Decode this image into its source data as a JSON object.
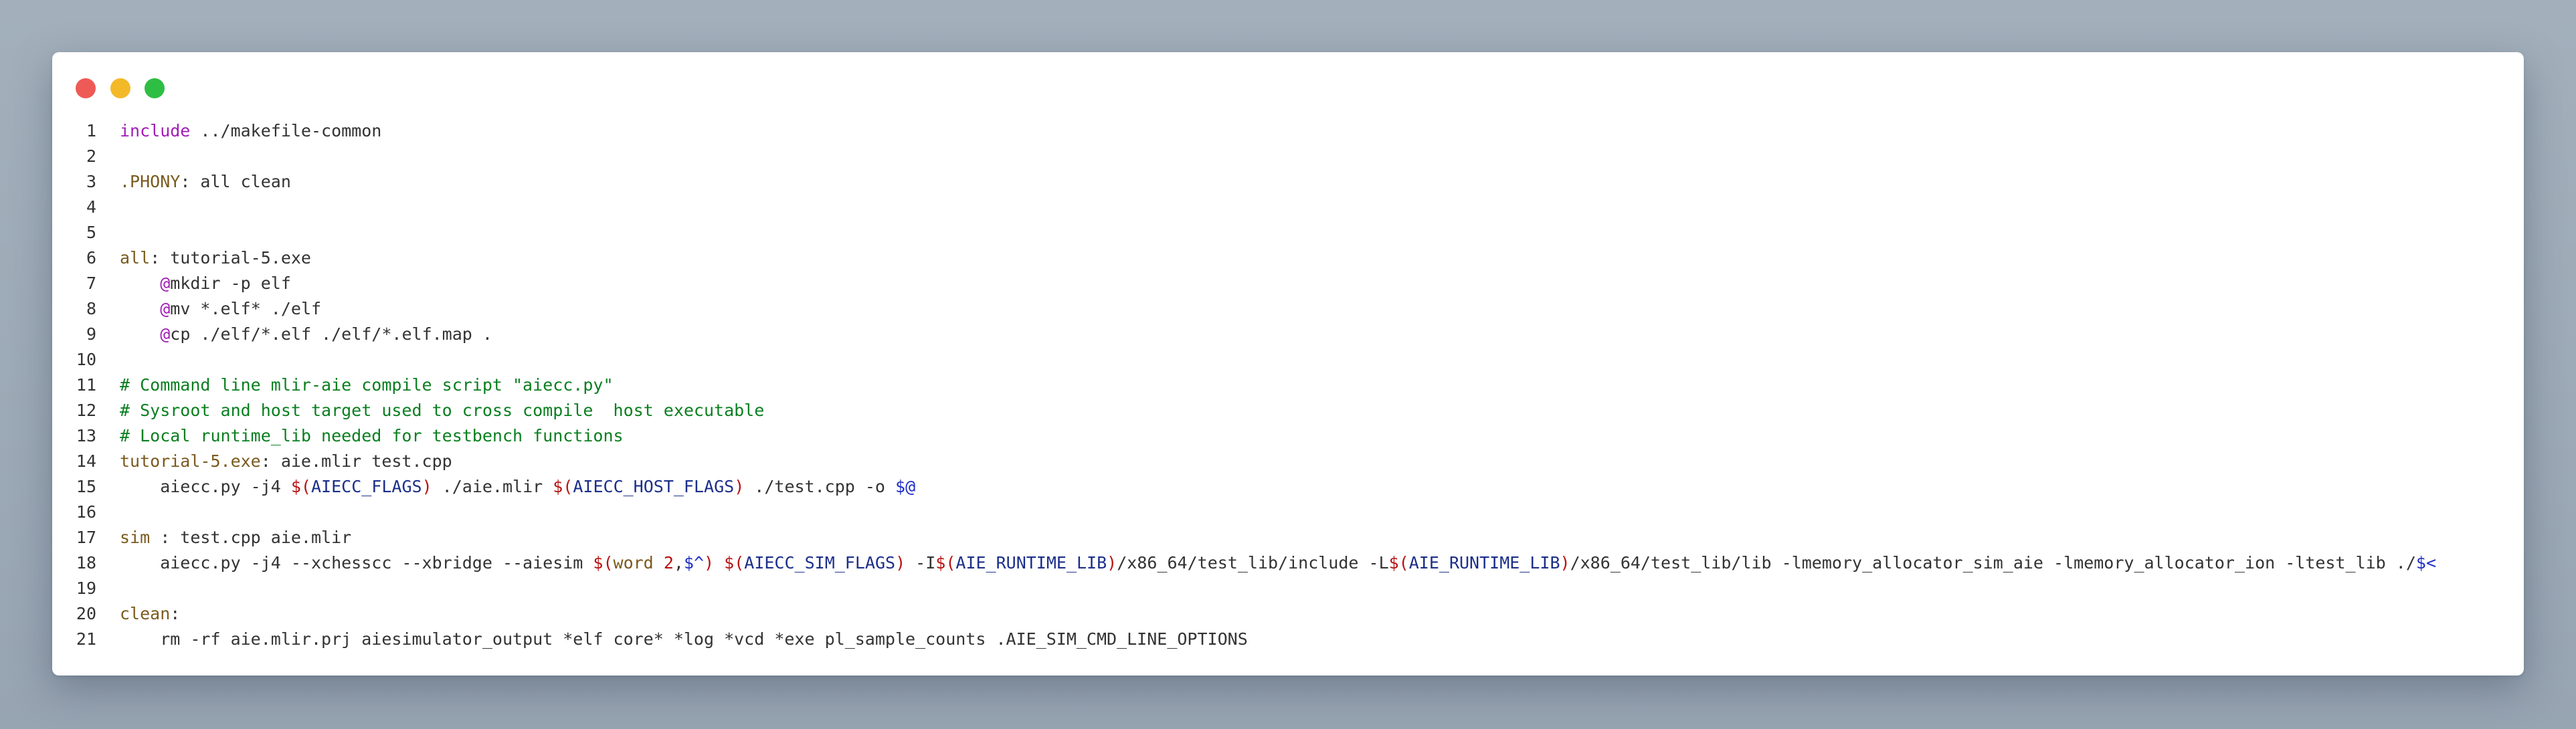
{
  "window": {
    "controls": [
      "close",
      "minimize",
      "maximize"
    ],
    "colors": {
      "close": "#ee5a56",
      "minimize": "#f4b929",
      "maximize": "#2fbe44"
    }
  },
  "code": {
    "language": "makefile",
    "lines": [
      {
        "n": "1",
        "tokens": [
          [
            "kw",
            "include"
          ],
          [
            "p",
            " ../makefile-common"
          ]
        ]
      },
      {
        "n": "2",
        "tokens": []
      },
      {
        "n": "3",
        "tokens": [
          [
            "tg",
            ".PHONY"
          ],
          [
            "p",
            ": all clean"
          ]
        ]
      },
      {
        "n": "4",
        "tokens": []
      },
      {
        "n": "5",
        "tokens": []
      },
      {
        "n": "6",
        "tokens": [
          [
            "tg",
            "all"
          ],
          [
            "p",
            ": tutorial-5.exe"
          ]
        ]
      },
      {
        "n": "7",
        "tokens": [
          [
            "p",
            "    "
          ],
          [
            "at",
            "@"
          ],
          [
            "p",
            "mkdir -p elf"
          ]
        ]
      },
      {
        "n": "8",
        "tokens": [
          [
            "p",
            "    "
          ],
          [
            "at",
            "@"
          ],
          [
            "p",
            "mv *.elf* ./elf"
          ]
        ]
      },
      {
        "n": "9",
        "tokens": [
          [
            "p",
            "    "
          ],
          [
            "at",
            "@"
          ],
          [
            "p",
            "cp ./elf/*.elf ./elf/*.elf.map ."
          ]
        ]
      },
      {
        "n": "10",
        "tokens": []
      },
      {
        "n": "11",
        "tokens": [
          [
            "cm",
            "# Command line mlir-aie compile script \"aiecc.py\""
          ]
        ]
      },
      {
        "n": "12",
        "tokens": [
          [
            "cm",
            "# Sysroot and host target used to cross compile  host executable"
          ]
        ]
      },
      {
        "n": "13",
        "tokens": [
          [
            "cm",
            "# Local runtime_lib needed for testbench functions"
          ]
        ]
      },
      {
        "n": "14",
        "tokens": [
          [
            "tg",
            "tutorial-5.exe"
          ],
          [
            "p",
            ": aie.mlir test.cpp"
          ]
        ]
      },
      {
        "n": "15",
        "tokens": [
          [
            "p",
            "    aiecc.py -j4 "
          ],
          [
            "dl",
            "$("
          ],
          [
            "vr",
            "AIECC_FLAGS"
          ],
          [
            "dl",
            ")"
          ],
          [
            "p",
            " ./aie.mlir "
          ],
          [
            "dl",
            "$("
          ],
          [
            "vr",
            "AIECC_HOST_FLAGS"
          ],
          [
            "dl",
            ")"
          ],
          [
            "p",
            " ./test.cpp -o "
          ],
          [
            "bl",
            "$@"
          ]
        ]
      },
      {
        "n": "16",
        "tokens": []
      },
      {
        "n": "17",
        "tokens": [
          [
            "tg",
            "sim"
          ],
          [
            "p",
            " : test.cpp aie.mlir"
          ]
        ]
      },
      {
        "n": "18",
        "tokens": [
          [
            "p",
            "    aiecc.py -j4 --xchesscc --xbridge --aiesim "
          ],
          [
            "dl",
            "$("
          ],
          [
            "fn",
            "word"
          ],
          [
            "p",
            " "
          ],
          [
            "nm",
            "2"
          ],
          [
            "p",
            ","
          ],
          [
            "bl",
            "$^"
          ],
          [
            "dl",
            ")"
          ],
          [
            "p",
            " "
          ],
          [
            "dl",
            "$("
          ],
          [
            "vr",
            "AIECC_SIM_FLAGS"
          ],
          [
            "dl",
            ")"
          ],
          [
            "p",
            " -I"
          ],
          [
            "dl",
            "$("
          ],
          [
            "vr",
            "AIE_RUNTIME_LIB"
          ],
          [
            "dl",
            ")"
          ],
          [
            "p",
            "/x86_64/test_lib/include -L"
          ],
          [
            "dl",
            "$("
          ],
          [
            "vr",
            "AIE_RUNTIME_LIB"
          ],
          [
            "dl",
            ")"
          ],
          [
            "p",
            "/x86_64/test_lib/lib -lmemory_allocator_sim_aie -lmemory_allocator_ion -ltest_lib ./"
          ],
          [
            "bl",
            "$<"
          ]
        ]
      },
      {
        "n": "19",
        "tokens": []
      },
      {
        "n": "20",
        "tokens": [
          [
            "tg",
            "clean"
          ],
          [
            "p",
            ":"
          ]
        ]
      },
      {
        "n": "21",
        "tokens": [
          [
            "p",
            "    rm -rf aie.mlir.prj aiesimulator_output *elf core* *log *vcd *exe pl_sample_counts .AIE_SIM_CMD_LINE_OPTIONS"
          ]
        ]
      }
    ]
  }
}
